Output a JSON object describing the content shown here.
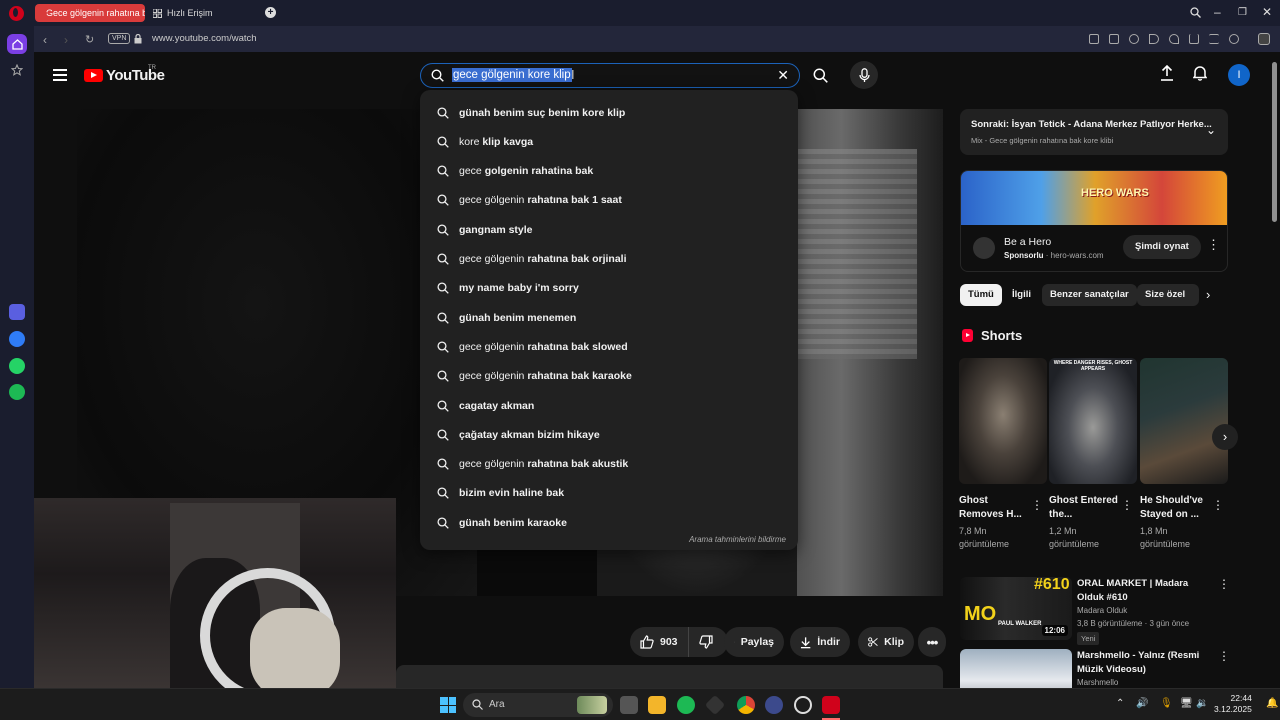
{
  "browser": {
    "tabs": [
      {
        "label": "Gece gölgenin rahatına b",
        "active": true
      },
      {
        "label": "Hızlı Erişim",
        "active": false
      }
    ],
    "vpn_label": "VPN",
    "url": "www.youtube.com/watch"
  },
  "youtube": {
    "logo_text": "YouTube",
    "region": "TR",
    "search_value": "gece gölgenin kore klip",
    "avatar_letter": "I",
    "suggestions": [
      {
        "prefix": "",
        "bold": "günah benim suç benim kore klip"
      },
      {
        "prefix": "kore ",
        "bold": "klip kavga"
      },
      {
        "prefix": "gece ",
        "bold": "golgenin rahatina bak"
      },
      {
        "prefix": "gece gölgenin ",
        "bold": "rahatına bak 1 saat"
      },
      {
        "prefix": "",
        "bold": "gangnam style"
      },
      {
        "prefix": "gece gölgenin ",
        "bold": "rahatına bak orjinali"
      },
      {
        "prefix": "",
        "bold": "my name baby i'm sorry"
      },
      {
        "prefix": "",
        "bold": "günah benim menemen"
      },
      {
        "prefix": "gece gölgenin ",
        "bold": "rahatına bak slowed"
      },
      {
        "prefix": "gece gölgenin ",
        "bold": "rahatına bak karaoke"
      },
      {
        "prefix": "",
        "bold": "cagatay akman"
      },
      {
        "prefix": "",
        "bold": "çağatay akman bizim hikaye"
      },
      {
        "prefix": "gece gölgenin ",
        "bold": "rahatına bak akustik"
      },
      {
        "prefix": "",
        "bold": "bizim evin haline bak"
      },
      {
        "prefix": "",
        "bold": "günah benim karaoke"
      }
    ],
    "report_text": "Arama tahminlerini bildirme",
    "actions": {
      "likes": "903",
      "share": "Paylaş",
      "download": "İndir",
      "clip": "Klip"
    },
    "up_next": {
      "title": "Sonraki: İsyan Tetick - Adana Merkez Patlıyor Herke...",
      "subtitle": "Mix - Gece gölgenin rahatına bak kore klibi"
    },
    "ad": {
      "banner_text": "HERO WARS",
      "title": "Be a Hero",
      "sponsored": "Sponsorlu",
      "domain": "· hero-wars.com",
      "cta": "Şimdi oynat"
    },
    "chips": [
      "Tümü",
      "İlgili",
      "Benzer sanatçılar",
      "Size özel"
    ],
    "shorts_title": "Shorts",
    "shorts": [
      {
        "title": "Ghost Removes H...",
        "views": "7,8 Mn görüntüleme"
      },
      {
        "title": "Ghost Entered the...",
        "views": "1,2 Mn görüntüleme"
      },
      {
        "title": "He Should've Stayed on ...",
        "views": "1,8 Mn görüntüleme"
      }
    ],
    "short2_caption": "WHERE DANGER RISES, GHOST APPEARS",
    "videos": [
      {
        "title": "ORAL MARKET | Madara Olduk #610",
        "channel": "Madara Olduk",
        "meta": "3,8 B görüntüleme · 3 gün önce",
        "badge": "Yeni",
        "duration": "12:06",
        "thumb_tag": "#610",
        "thumb_logo": "MO",
        "thumb_name": "PAUL WALKER"
      },
      {
        "title": "Marshmello - Yalnız (Resmi Müzik Videosu)",
        "channel": "Marshmello"
      }
    ]
  },
  "taskbar": {
    "search_placeholder": "Ara",
    "time": "22:44",
    "date": "3.12.2025"
  }
}
